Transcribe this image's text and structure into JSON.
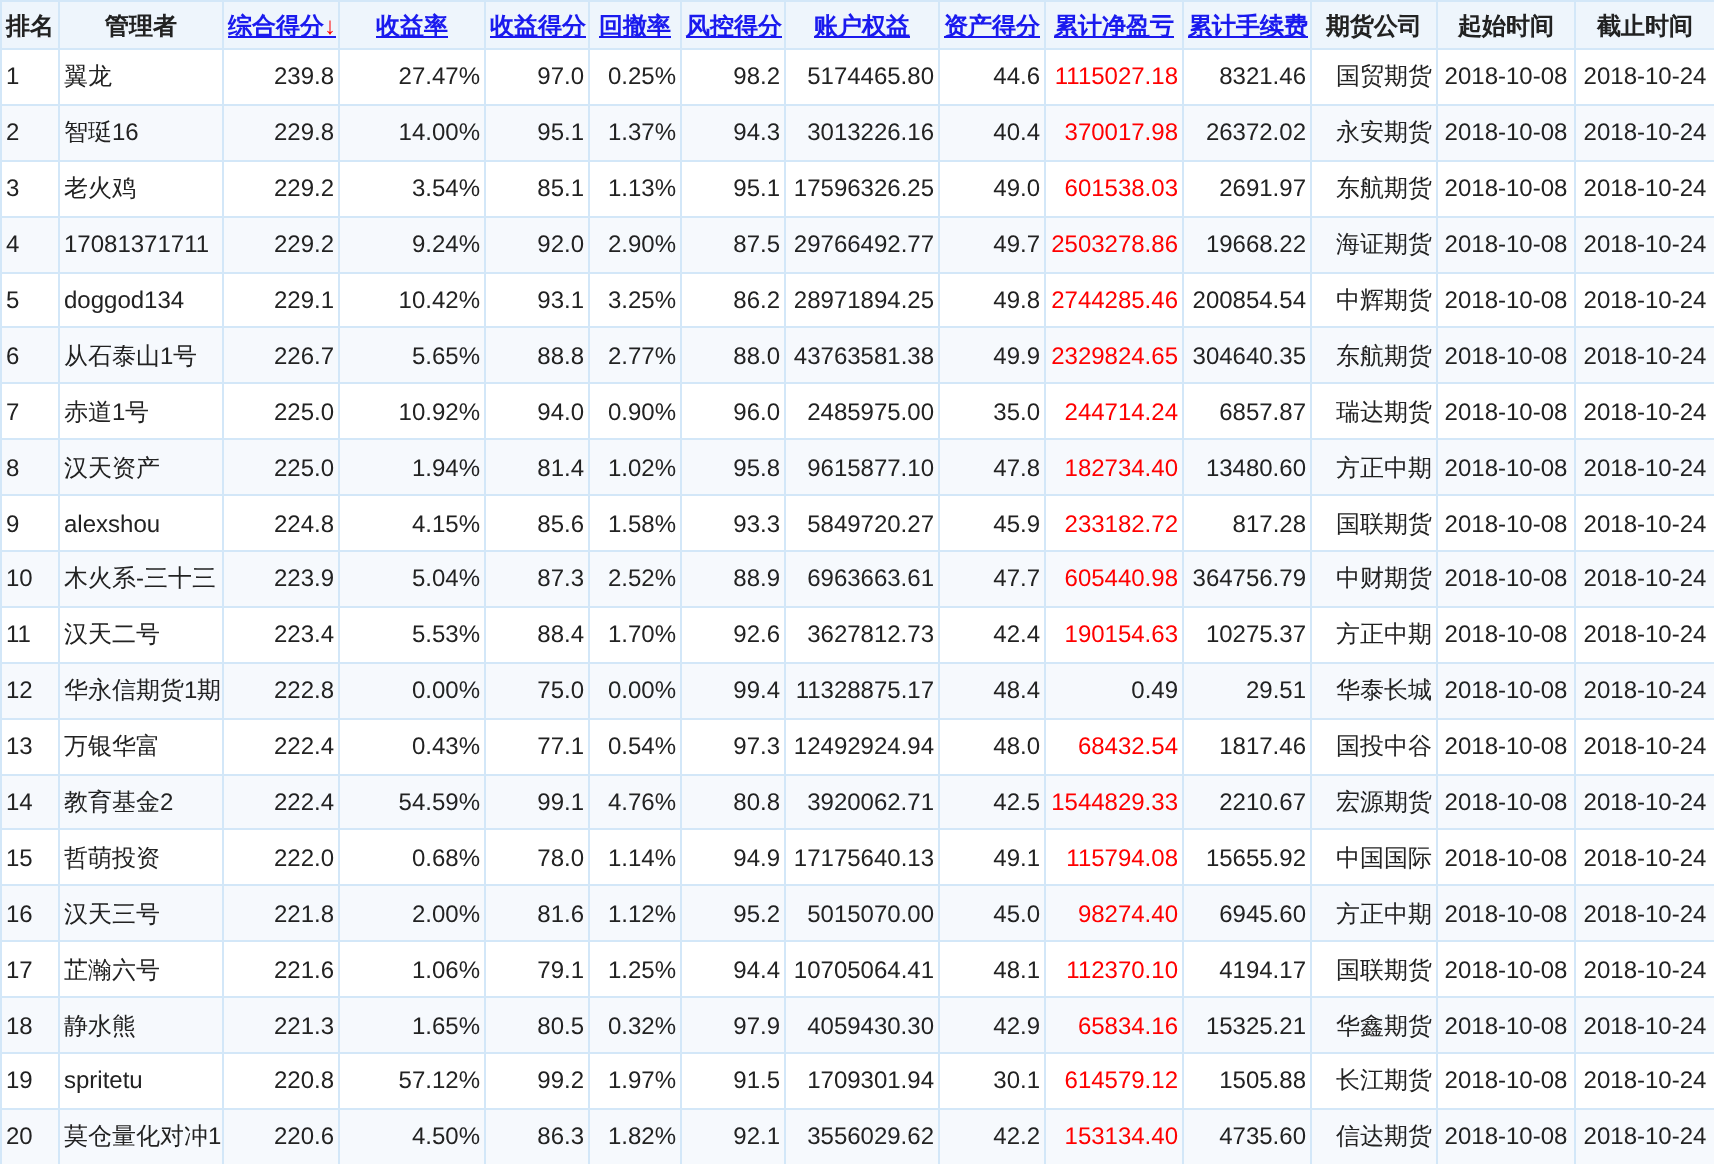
{
  "table": {
    "columns": [
      {
        "label": "排名",
        "sortable": false
      },
      {
        "label": "管理者",
        "sortable": false
      },
      {
        "label": "综合得分",
        "sortable": true,
        "sort_mark": "↓"
      },
      {
        "label": "收益率",
        "sortable": true
      },
      {
        "label": "收益得分",
        "sortable": true
      },
      {
        "label": "回撤率",
        "sortable": true
      },
      {
        "label": "风控得分",
        "sortable": true
      },
      {
        "label": "账户权益",
        "sortable": true
      },
      {
        "label": "资产得分",
        "sortable": true
      },
      {
        "label": "累计净盈亏",
        "sortable": true
      },
      {
        "label": "累计手续费",
        "sortable": true
      },
      {
        "label": "期货公司",
        "sortable": false
      },
      {
        "label": "起始时间",
        "sortable": false
      },
      {
        "label": "截止时间",
        "sortable": false
      }
    ],
    "rows": [
      {
        "rank": "1",
        "manager": "翼龙",
        "score": "239.8",
        "return": "27.47%",
        "return_score": "97.0",
        "drawdown": "0.25%",
        "risk_score": "98.2",
        "equity": "5174465.80",
        "asset_score": "44.6",
        "net_pnl": "1115027.18",
        "pnl_highlight": true,
        "fees": "8321.46",
        "company": "国贸期货",
        "start": "2018-10-08",
        "end": "2018-10-24"
      },
      {
        "rank": "2",
        "manager": "智珽16",
        "score": "229.8",
        "return": "14.00%",
        "return_score": "95.1",
        "drawdown": "1.37%",
        "risk_score": "94.3",
        "equity": "3013226.16",
        "asset_score": "40.4",
        "net_pnl": "370017.98",
        "pnl_highlight": true,
        "fees": "26372.02",
        "company": "永安期货",
        "start": "2018-10-08",
        "end": "2018-10-24"
      },
      {
        "rank": "3",
        "manager": "老火鸡",
        "score": "229.2",
        "return": "3.54%",
        "return_score": "85.1",
        "drawdown": "1.13%",
        "risk_score": "95.1",
        "equity": "17596326.25",
        "asset_score": "49.0",
        "net_pnl": "601538.03",
        "pnl_highlight": true,
        "fees": "2691.97",
        "company": "东航期货",
        "start": "2018-10-08",
        "end": "2018-10-24"
      },
      {
        "rank": "4",
        "manager": "17081371711",
        "score": "229.2",
        "return": "9.24%",
        "return_score": "92.0",
        "drawdown": "2.90%",
        "risk_score": "87.5",
        "equity": "29766492.77",
        "asset_score": "49.7",
        "net_pnl": "2503278.86",
        "pnl_highlight": true,
        "fees": "19668.22",
        "company": "海证期货",
        "start": "2018-10-08",
        "end": "2018-10-24"
      },
      {
        "rank": "5",
        "manager": "doggod134",
        "score": "229.1",
        "return": "10.42%",
        "return_score": "93.1",
        "drawdown": "3.25%",
        "risk_score": "86.2",
        "equity": "28971894.25",
        "asset_score": "49.8",
        "net_pnl": "2744285.46",
        "pnl_highlight": true,
        "fees": "200854.54",
        "company": "中辉期货",
        "start": "2018-10-08",
        "end": "2018-10-24"
      },
      {
        "rank": "6",
        "manager": "从石泰山1号",
        "score": "226.7",
        "return": "5.65%",
        "return_score": "88.8",
        "drawdown": "2.77%",
        "risk_score": "88.0",
        "equity": "43763581.38",
        "asset_score": "49.9",
        "net_pnl": "2329824.65",
        "pnl_highlight": true,
        "fees": "304640.35",
        "company": "东航期货",
        "start": "2018-10-08",
        "end": "2018-10-24"
      },
      {
        "rank": "7",
        "manager": "赤道1号",
        "score": "225.0",
        "return": "10.92%",
        "return_score": "94.0",
        "drawdown": "0.90%",
        "risk_score": "96.0",
        "equity": "2485975.00",
        "asset_score": "35.0",
        "net_pnl": "244714.24",
        "pnl_highlight": true,
        "fees": "6857.87",
        "company": "瑞达期货",
        "start": "2018-10-08",
        "end": "2018-10-24"
      },
      {
        "rank": "8",
        "manager": "汉天资产",
        "score": "225.0",
        "return": "1.94%",
        "return_score": "81.4",
        "drawdown": "1.02%",
        "risk_score": "95.8",
        "equity": "9615877.10",
        "asset_score": "47.8",
        "net_pnl": "182734.40",
        "pnl_highlight": true,
        "fees": "13480.60",
        "company": "方正中期",
        "start": "2018-10-08",
        "end": "2018-10-24"
      },
      {
        "rank": "9",
        "manager": "alexshou",
        "score": "224.8",
        "return": "4.15%",
        "return_score": "85.6",
        "drawdown": "1.58%",
        "risk_score": "93.3",
        "equity": "5849720.27",
        "asset_score": "45.9",
        "net_pnl": "233182.72",
        "pnl_highlight": true,
        "fees": "817.28",
        "company": "国联期货",
        "start": "2018-10-08",
        "end": "2018-10-24"
      },
      {
        "rank": "10",
        "manager": "木火系-三十三",
        "score": "223.9",
        "return": "5.04%",
        "return_score": "87.3",
        "drawdown": "2.52%",
        "risk_score": "88.9",
        "equity": "6963663.61",
        "asset_score": "47.7",
        "net_pnl": "605440.98",
        "pnl_highlight": true,
        "fees": "364756.79",
        "company": "中财期货",
        "start": "2018-10-08",
        "end": "2018-10-24"
      },
      {
        "rank": "11",
        "manager": "汉天二号",
        "score": "223.4",
        "return": "5.53%",
        "return_score": "88.4",
        "drawdown": "1.70%",
        "risk_score": "92.6",
        "equity": "3627812.73",
        "asset_score": "42.4",
        "net_pnl": "190154.63",
        "pnl_highlight": true,
        "fees": "10275.37",
        "company": "方正中期",
        "start": "2018-10-08",
        "end": "2018-10-24"
      },
      {
        "rank": "12",
        "manager": "华永信期货1期",
        "score": "222.8",
        "return": "0.00%",
        "return_score": "75.0",
        "drawdown": "0.00%",
        "risk_score": "99.4",
        "equity": "11328875.17",
        "asset_score": "48.4",
        "net_pnl": "0.49",
        "pnl_highlight": false,
        "fees": "29.51",
        "company": "华泰长城",
        "start": "2018-10-08",
        "end": "2018-10-24"
      },
      {
        "rank": "13",
        "manager": "万银华富",
        "score": "222.4",
        "return": "0.43%",
        "return_score": "77.1",
        "drawdown": "0.54%",
        "risk_score": "97.3",
        "equity": "12492924.94",
        "asset_score": "48.0",
        "net_pnl": "68432.54",
        "pnl_highlight": true,
        "fees": "1817.46",
        "company": "国投中谷",
        "start": "2018-10-08",
        "end": "2018-10-24"
      },
      {
        "rank": "14",
        "manager": "教育基金2",
        "score": "222.4",
        "return": "54.59%",
        "return_score": "99.1",
        "drawdown": "4.76%",
        "risk_score": "80.8",
        "equity": "3920062.71",
        "asset_score": "42.5",
        "net_pnl": "1544829.33",
        "pnl_highlight": true,
        "fees": "2210.67",
        "company": "宏源期货",
        "start": "2018-10-08",
        "end": "2018-10-24"
      },
      {
        "rank": "15",
        "manager": "哲萌投资",
        "score": "222.0",
        "return": "0.68%",
        "return_score": "78.0",
        "drawdown": "1.14%",
        "risk_score": "94.9",
        "equity": "17175640.13",
        "asset_score": "49.1",
        "net_pnl": "115794.08",
        "pnl_highlight": true,
        "fees": "15655.92",
        "company": "中国国际",
        "start": "2018-10-08",
        "end": "2018-10-24"
      },
      {
        "rank": "16",
        "manager": "汉天三号",
        "score": "221.8",
        "return": "2.00%",
        "return_score": "81.6",
        "drawdown": "1.12%",
        "risk_score": "95.2",
        "equity": "5015070.00",
        "asset_score": "45.0",
        "net_pnl": "98274.40",
        "pnl_highlight": true,
        "fees": "6945.60",
        "company": "方正中期",
        "start": "2018-10-08",
        "end": "2018-10-24"
      },
      {
        "rank": "17",
        "manager": "芷瀚六号",
        "score": "221.6",
        "return": "1.06%",
        "return_score": "79.1",
        "drawdown": "1.25%",
        "risk_score": "94.4",
        "equity": "10705064.41",
        "asset_score": "48.1",
        "net_pnl": "112370.10",
        "pnl_highlight": true,
        "fees": "4194.17",
        "company": "国联期货",
        "start": "2018-10-08",
        "end": "2018-10-24"
      },
      {
        "rank": "18",
        "manager": "静水熊",
        "score": "221.3",
        "return": "1.65%",
        "return_score": "80.5",
        "drawdown": "0.32%",
        "risk_score": "97.9",
        "equity": "4059430.30",
        "asset_score": "42.9",
        "net_pnl": "65834.16",
        "pnl_highlight": true,
        "fees": "15325.21",
        "company": "华鑫期货",
        "start": "2018-10-08",
        "end": "2018-10-24"
      },
      {
        "rank": "19",
        "manager": "spritetu",
        "score": "220.8",
        "return": "57.12%",
        "return_score": "99.2",
        "drawdown": "1.97%",
        "risk_score": "91.5",
        "equity": "1709301.94",
        "asset_score": "30.1",
        "net_pnl": "614579.12",
        "pnl_highlight": true,
        "fees": "1505.88",
        "company": "长江期货",
        "start": "2018-10-08",
        "end": "2018-10-24"
      },
      {
        "rank": "20",
        "manager": "莫仓量化对冲1",
        "score": "220.6",
        "return": "4.50%",
        "return_score": "86.3",
        "drawdown": "1.82%",
        "risk_score": "92.1",
        "equity": "3556029.62",
        "asset_score": "42.2",
        "net_pnl": "153134.40",
        "pnl_highlight": true,
        "fees": "4735.60",
        "company": "信达期货",
        "start": "2018-10-08",
        "end": "2018-10-24"
      }
    ]
  }
}
